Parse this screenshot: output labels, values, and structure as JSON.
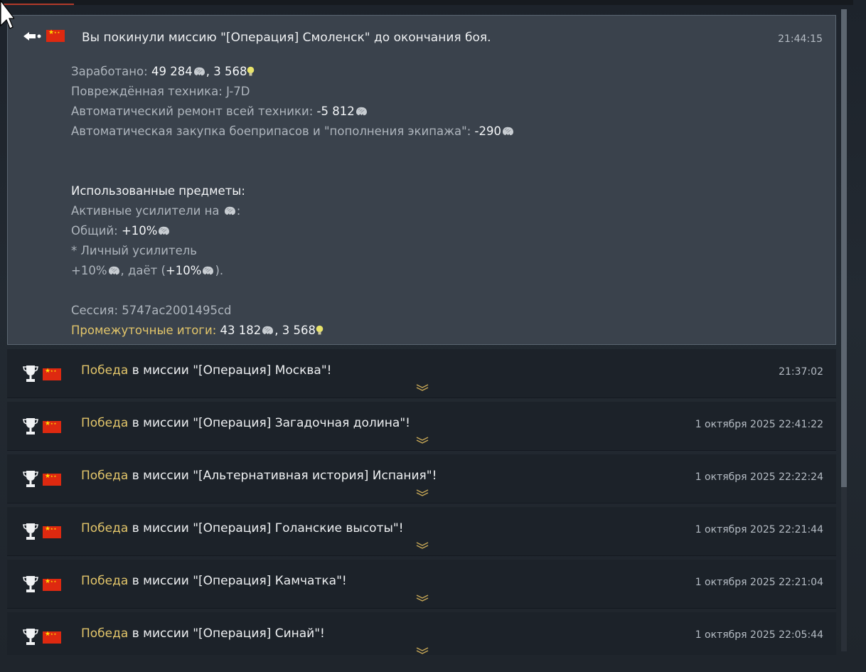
{
  "expanded": {
    "title": "Вы покинули миссию \"[Операция] Смоленск\" до окончания боя.",
    "time": "21:44:15",
    "earned_label": "Заработано: ",
    "earned_silver": "49 284",
    "earned_sep": ", ",
    "earned_rp": "3 568",
    "damaged_label": "Повреждённая техника: ",
    "damaged_value": "J-7D",
    "repair_label": "Автоматический ремонт всей техники: ",
    "repair_value": "-5 812",
    "ammo_label": "Автоматическая закупка боеприпасов и \"пополнения экипажа\": ",
    "ammo_value": "-290",
    "used_items_heading": "Использованные предметы:",
    "boosters_label": "Активные усилители на ",
    "boosters_colon": ":",
    "general_label": "Общий: ",
    "general_value": "+10%",
    "personal_label": "* Личный усилитель",
    "personal_value": "+10%",
    "gives_label": ", даёт (",
    "gives_value": "+10%",
    "gives_close": ").",
    "session_label": "Сессия: ",
    "session_value": "5747ac2001495cd",
    "subtotal_label": "Промежуточные итоги: ",
    "subtotal_silver": "43 182",
    "subtotal_sep": ", ",
    "subtotal_rp": "3 568"
  },
  "victory_word": "Победа",
  "entries": [
    {
      "mission": " в миссии \"[Операция] Москва\"!",
      "time": "21:37:02"
    },
    {
      "mission": " в миссии \"[Операция] Загадочная долина\"!",
      "time": "1 октября 2025 22:41:22"
    },
    {
      "mission": " в миссии \"[Альтернативная история] Испания\"!",
      "time": "1 октября 2025 22:22:24"
    },
    {
      "mission": " в миссии \"[Операция] Голанские высоты\"!",
      "time": "1 октября 2025 22:21:44"
    },
    {
      "mission": " в миссии \"[Операция] Камчатка\"!",
      "time": "1 октября 2025 22:21:04"
    },
    {
      "mission": " в миссии \"[Операция] Синай\"!",
      "time": "1 октября 2025 22:05:44"
    }
  ],
  "colors": {
    "accent_gold": "#e2c56a",
    "bulb": "#e8e36a",
    "flag_red": "#de2910",
    "flag_star": "#ffde00"
  },
  "icons": [
    "left-arrow-icon",
    "flag-china-icon",
    "lion-silver-icon",
    "bulb-rp-icon",
    "trophy-icon",
    "chevron-down-icon",
    "mouse-cursor-icon"
  ]
}
